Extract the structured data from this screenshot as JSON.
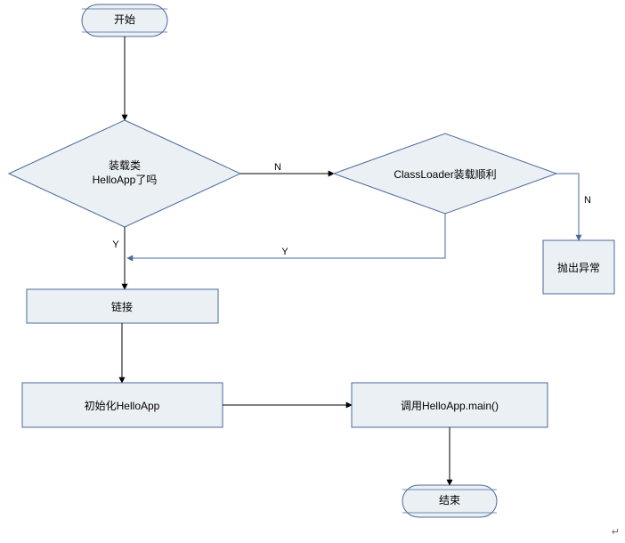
{
  "chart_data": {
    "type": "flowchart",
    "nodes": [
      {
        "id": "start",
        "kind": "terminator",
        "label": "开始"
      },
      {
        "id": "loaded_q",
        "kind": "decision",
        "label_line1": "装载类",
        "label_line2": "HelloApp了吗"
      },
      {
        "id": "classloader_q",
        "kind": "decision",
        "label": "ClassLoader装载顺利"
      },
      {
        "id": "throw",
        "kind": "process",
        "label": "抛出异常"
      },
      {
        "id": "link",
        "kind": "process",
        "label": "链接"
      },
      {
        "id": "init",
        "kind": "process",
        "label": "初始化HelloApp"
      },
      {
        "id": "call",
        "kind": "process",
        "label": "调用HelloApp.main()"
      },
      {
        "id": "end",
        "kind": "terminator",
        "label": "结束"
      }
    ],
    "edges": [
      {
        "from": "start",
        "to": "loaded_q",
        "label": ""
      },
      {
        "from": "loaded_q",
        "to": "classloader_q",
        "label": "N"
      },
      {
        "from": "loaded_q",
        "to": "link",
        "label": "Y"
      },
      {
        "from": "classloader_q",
        "to": "throw",
        "label": "N"
      },
      {
        "from": "classloader_q",
        "to": "loaded_q_yes",
        "label": "Y"
      },
      {
        "from": "link",
        "to": "init",
        "label": ""
      },
      {
        "from": "init",
        "to": "call",
        "label": ""
      },
      {
        "from": "call",
        "to": "end",
        "label": ""
      }
    ]
  },
  "labels": {
    "start": "开始",
    "loaded_line1": "装载类",
    "loaded_line2": "HelloApp了吗",
    "classloader": "ClassLoader装载顺利",
    "throw": "抛出异常",
    "link": "链接",
    "init": "初始化HelloApp",
    "call": "调用HelloApp.main()",
    "end": "结束",
    "edge_N1": "N",
    "edge_N2": "N",
    "edge_Y1": "Y",
    "edge_Y2": "Y"
  },
  "footer_mark": "↵"
}
